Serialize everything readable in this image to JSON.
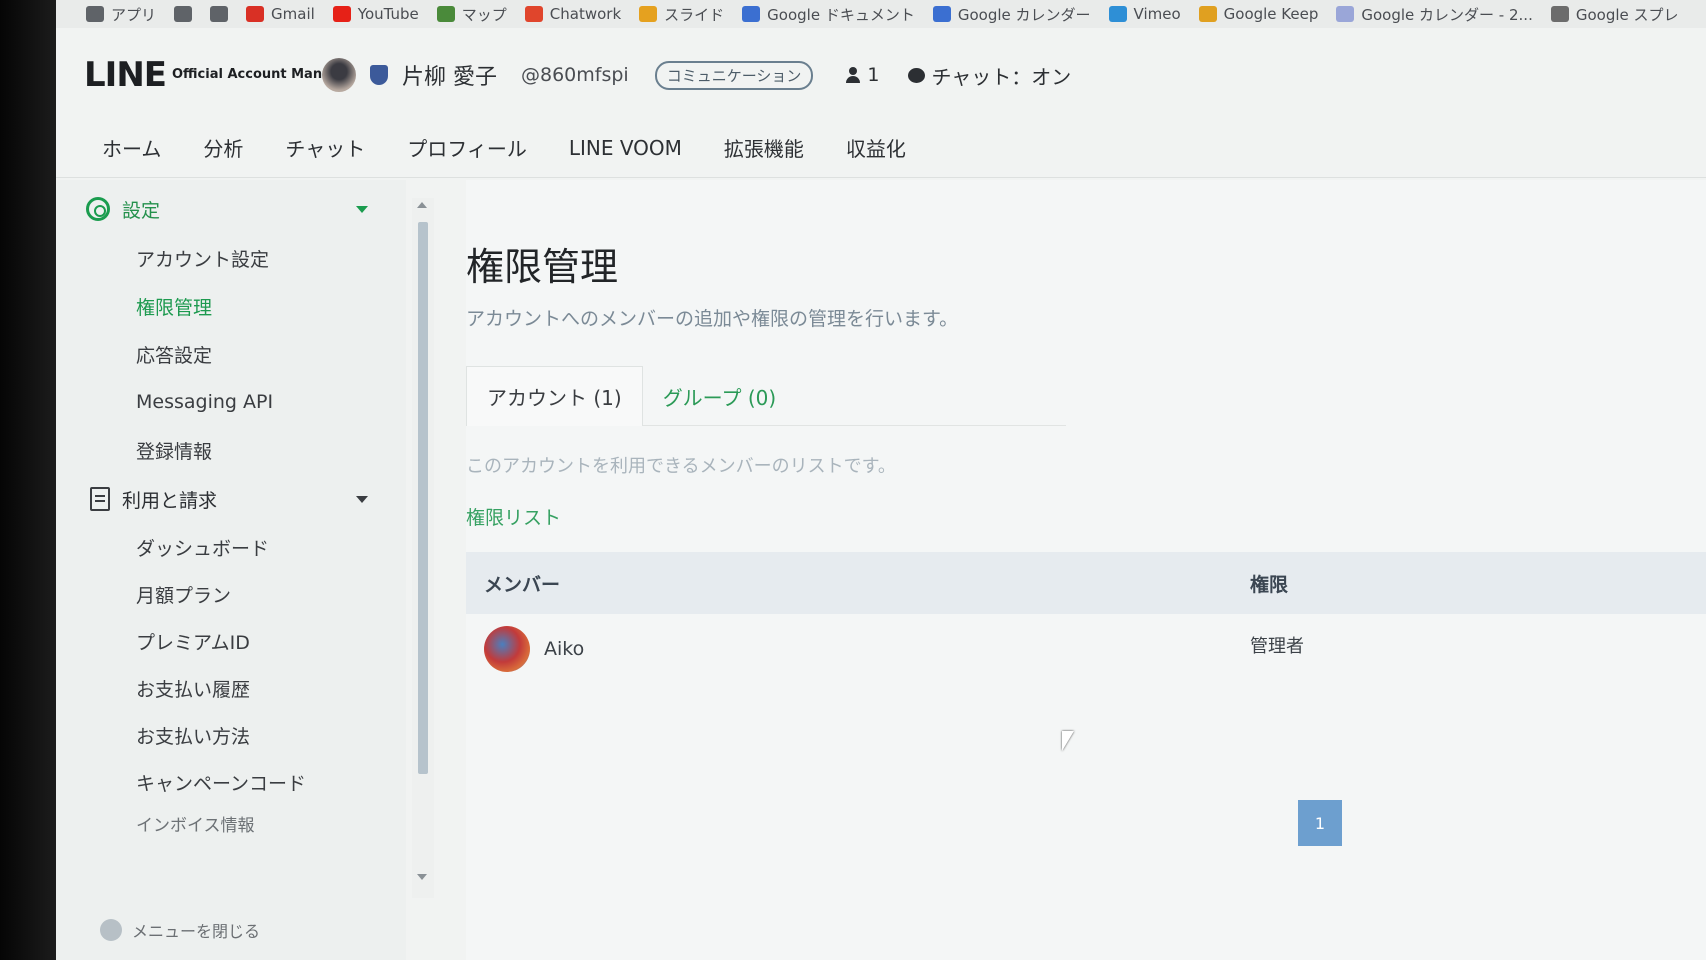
{
  "bookmarks": [
    {
      "label": "アプリ",
      "icon": "apps-icon",
      "color": "#5f6368"
    },
    {
      "label": "",
      "icon": "grid-icon",
      "color": "#5f6368"
    },
    {
      "label": "",
      "icon": "bookmark-icon",
      "color": "#5f6368"
    },
    {
      "label": "Gmail",
      "icon": "gmail-icon",
      "color": "#d93025"
    },
    {
      "label": "YouTube",
      "icon": "youtube-icon",
      "color": "#e62117"
    },
    {
      "label": "マップ",
      "icon": "maps-icon",
      "color": "#4a8a3a"
    },
    {
      "label": "Chatwork",
      "icon": "chatwork-icon",
      "color": "#e0452c"
    },
    {
      "label": "スライド",
      "icon": "slides-icon",
      "color": "#e5a11f"
    },
    {
      "label": "Google ドキュメント",
      "icon": "docs-icon",
      "color": "#3b6fd1"
    },
    {
      "label": "Google カレンダー",
      "icon": "calendar-icon",
      "color": "#3b6fd1"
    },
    {
      "label": "Vimeo",
      "icon": "vimeo-icon",
      "color": "#2e8fd6"
    },
    {
      "label": "Google Keep",
      "icon": "keep-icon",
      "color": "#e0a020"
    },
    {
      "label": "Google カレンダー - 2...",
      "icon": "calendar-icon",
      "color": "#9aa6d8"
    },
    {
      "label": "Google スプレ",
      "icon": "sheets-icon",
      "color": "#6c6c6c"
    }
  ],
  "header": {
    "logo_word": "LINE",
    "logo_sub": "Official Account Manager",
    "account_name": "片柳 愛子",
    "account_id": "@860mfspi",
    "plan_badge": "コミュニケーション",
    "friends_count": "1",
    "chat_status": "チャット：オン"
  },
  "nav": [
    "ホーム",
    "分析",
    "チャット",
    "プロフィール",
    "LINE VOOM",
    "拡張機能",
    "収益化"
  ],
  "sidebar": {
    "settings_label": "設定",
    "settings_items": [
      "アカウント設定",
      "権限管理",
      "応答設定",
      "Messaging API",
      "登録情報"
    ],
    "active_item": "権限管理",
    "billing_label": "利用と請求",
    "billing_items": [
      "ダッシュボード",
      "月額プラン",
      "プレミアムID",
      "お支払い履歴",
      "お支払い方法",
      "キャンペーンコード"
    ],
    "partial_item": "インボイス情報",
    "close_menu": "メニューを閉じる"
  },
  "main": {
    "title": "権限管理",
    "description": "アカウントへのメンバーの追加や権限の管理を行います。",
    "tabs": [
      {
        "label": "アカウント (1)",
        "active": true
      },
      {
        "label": "グループ (0)",
        "active": false
      }
    ],
    "tab_description": "このアカウントを利用できるメンバーのリストです。",
    "list_heading": "権限リスト",
    "columns": {
      "member": "メンバー",
      "role": "権限"
    },
    "rows": [
      {
        "name": "Aiko",
        "role": "管理者"
      }
    ],
    "page": "1"
  },
  "colors": {
    "accent": "#1d9a4f",
    "pagination": "#6d9fcf"
  }
}
